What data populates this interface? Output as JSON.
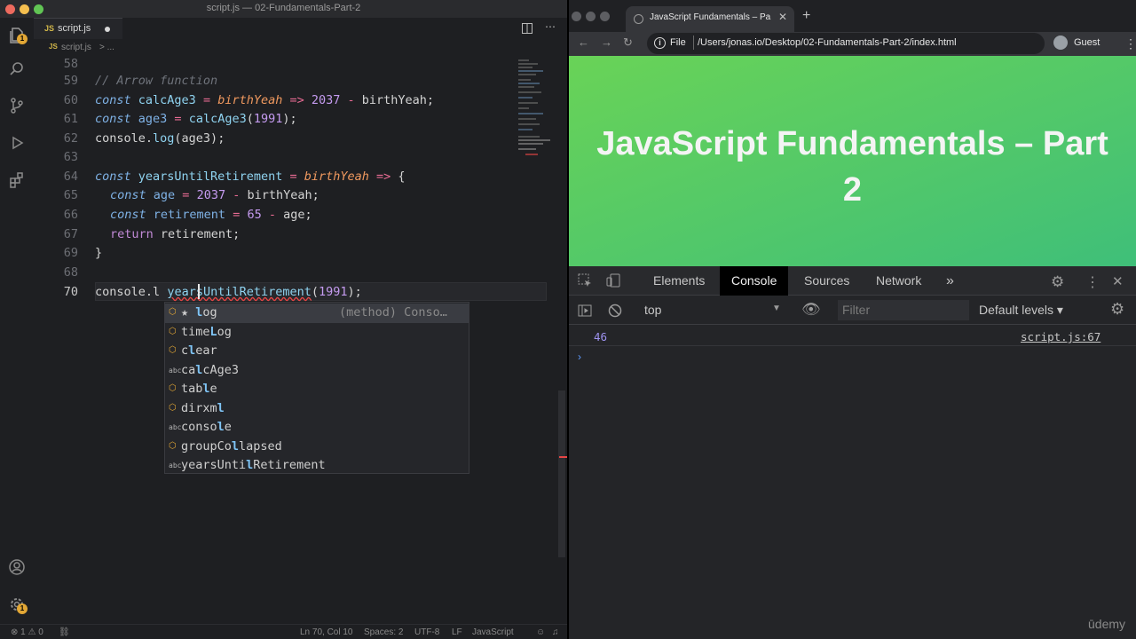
{
  "vscode": {
    "window_title": "script.js — 02-Fundamentals-Part-2",
    "tab": {
      "icon": "JS",
      "name": "script.js"
    },
    "breadcrumb": {
      "icon": "JS",
      "file": "script.js",
      "sep": "> ..."
    },
    "activity_badges": {
      "explorer": "1",
      "accounts": "1"
    },
    "lines": [
      {
        "n": "58"
      },
      {
        "n": "59"
      },
      {
        "n": "60"
      },
      {
        "n": "61"
      },
      {
        "n": "62"
      },
      {
        "n": "63"
      },
      {
        "n": "64"
      },
      {
        "n": "65"
      },
      {
        "n": "66"
      },
      {
        "n": "67"
      },
      {
        "n": "68"
      },
      {
        "n": "69"
      },
      {
        "n": "70"
      }
    ],
    "code": {
      "l59_comment": "// Arrow function",
      "l60": {
        "kw": "const",
        "name": "calcAge3",
        "eq": " = ",
        "param": "birthYeah",
        "arrow": " => ",
        "num": "2037",
        "minus": " - ",
        "rest": "birthYeah;"
      },
      "l61": {
        "kw": "const",
        "name": "age3",
        "eq": " = ",
        "call": "calcAge3",
        "open": "(",
        "num": "1991",
        "close": ");"
      },
      "l62": {
        "obj": "console.",
        "method": "log",
        "rest": "(age3);"
      },
      "l64": {
        "kw": "const",
        "name": "yearsUntilRetirement",
        "eq": " = ",
        "param": "birthYeah",
        "arrow": " => ",
        "brace": "{"
      },
      "l65": {
        "kw": "const",
        "name": "age",
        "eq": " = ",
        "num": "2037",
        "minus": " - ",
        "rest": "birthYeah;"
      },
      "l66": {
        "kw": "const",
        "name": "retirement",
        "eq": " = ",
        "num": "65",
        "minus": " - ",
        "rest": "age;"
      },
      "l67": {
        "kw": "return",
        "rest": " retirement;"
      },
      "l68": "}",
      "l70": {
        "obj": "console.",
        "typed": "l",
        "call": "yearsUntilRetirement",
        "open": "(",
        "num": "1991",
        "close": ");"
      }
    },
    "suggestions": [
      {
        "icon": "method",
        "prefix": "★ ",
        "bold": "l",
        "rest": "og",
        "pre": "",
        "detail": "(method) Conso…"
      },
      {
        "icon": "method",
        "prefix": "",
        "pre": "time",
        "bold": "L",
        "rest": "og",
        "detail": ""
      },
      {
        "icon": "method",
        "prefix": "",
        "pre": "c",
        "bold": "l",
        "rest": "ear",
        "detail": ""
      },
      {
        "icon": "abc",
        "prefix": "",
        "pre": "ca",
        "bold": "l",
        "rest": "cAge3",
        "detail": ""
      },
      {
        "icon": "method",
        "prefix": "",
        "pre": "tab",
        "bold": "l",
        "rest": "e",
        "detail": ""
      },
      {
        "icon": "method",
        "prefix": "",
        "pre": "dirxm",
        "bold": "l",
        "rest": "",
        "detail": ""
      },
      {
        "icon": "abc",
        "prefix": "",
        "pre": "conso",
        "bold": "l",
        "rest": "e",
        "detail": ""
      },
      {
        "icon": "method",
        "prefix": "",
        "pre": "groupCo",
        "bold": "l",
        "rest": "lapsed",
        "detail": ""
      },
      {
        "icon": "abc",
        "prefix": "",
        "pre": "yearsUnti",
        "bold": "l",
        "rest": "Retirement",
        "detail": ""
      }
    ],
    "status": {
      "errors": "⊗ 1 ⚠ 0",
      "position": "Ln 70, Col 10",
      "spaces": "Spaces: 2",
      "encoding": "UTF-8",
      "eol": "LF",
      "language": "JavaScript"
    }
  },
  "browser": {
    "tab_title": "JavaScript Fundamentals – Pa",
    "url_scheme": "File",
    "url": "/Users/jonas.io/Desktop/02-Fundamentals-Part-2/index.html",
    "profile": "Guest",
    "page_heading": "JavaScript Fundamentals – Part 2",
    "devtools": {
      "tabs": [
        "Elements",
        "Console",
        "Sources",
        "Network"
      ],
      "active_tab": "Console",
      "more": "»",
      "context": "top",
      "filter_placeholder": "Filter",
      "levels": "Default levels ▾",
      "log_value": "46",
      "log_source": "script.js:67",
      "prompt": "›"
    }
  },
  "watermark": "ūdemy"
}
